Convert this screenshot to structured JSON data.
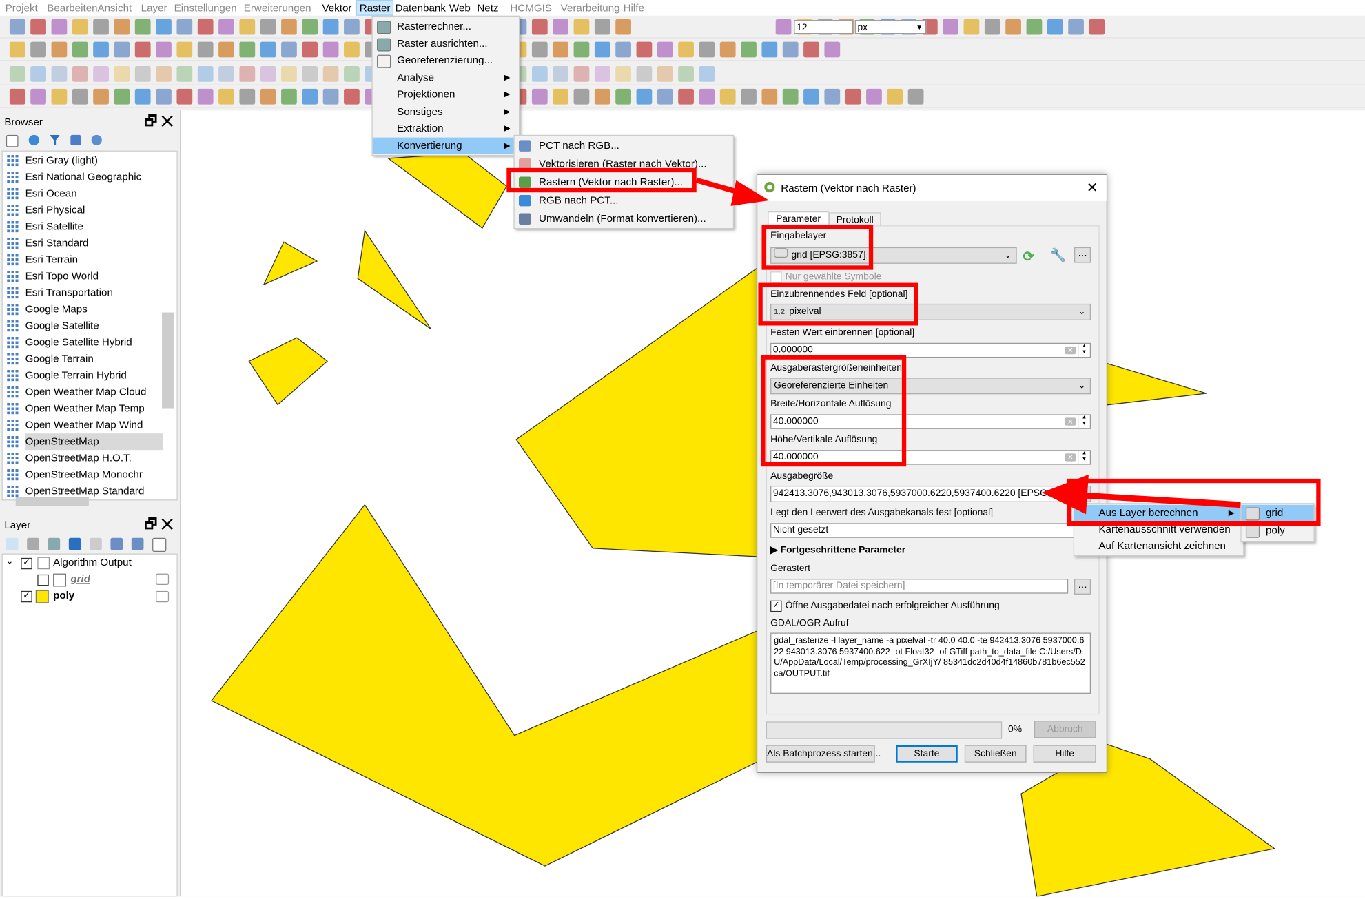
{
  "menubar": [
    {
      "label": "Projekt",
      "enabled": false
    },
    {
      "label": "Bearbeiten",
      "enabled": false
    },
    {
      "label": "Ansicht",
      "enabled": false
    },
    {
      "label": "Layer",
      "enabled": false
    },
    {
      "label": "Einstellungen",
      "enabled": false
    },
    {
      "label": "Erweiterungen",
      "enabled": false
    },
    {
      "label": "Vektor",
      "enabled": true
    },
    {
      "label": "Raster",
      "enabled": true,
      "active": true
    },
    {
      "label": "Datenbank",
      "enabled": true
    },
    {
      "label": "Web",
      "enabled": true
    },
    {
      "label": "Netz",
      "enabled": true
    },
    {
      "label": "HCMGIS",
      "enabled": false
    },
    {
      "label": "Verarbeitung",
      "enabled": false
    },
    {
      "label": "Hilfe",
      "enabled": false
    }
  ],
  "toolbar": {
    "scale_value": "12",
    "scale_unit": "px"
  },
  "raster_menu": {
    "items": [
      {
        "label": "Rasterrechner...",
        "submenu": false
      },
      {
        "label": "Raster ausrichten...",
        "submenu": false
      },
      {
        "label": "Georeferenzierung...",
        "submenu": false
      },
      {
        "label": "Analyse",
        "submenu": true
      },
      {
        "label": "Projektionen",
        "submenu": true
      },
      {
        "label": "Sonstiges",
        "submenu": true
      },
      {
        "label": "Extraktion",
        "submenu": true
      },
      {
        "label": "Konvertierung",
        "submenu": true,
        "highlighted": true
      }
    ]
  },
  "konvertierung_menu": {
    "items": [
      {
        "label": "PCT nach RGB...",
        "enabled": true
      },
      {
        "label": "Vektorisieren (Raster nach Vektor)...",
        "enabled": true
      },
      {
        "label": "Rastern (Vektor nach Raster)...",
        "enabled": true
      },
      {
        "label": "RGB nach PCT...",
        "enabled": true
      },
      {
        "label": "Umwandeln (Format konvertieren)...",
        "enabled": true
      }
    ]
  },
  "browser": {
    "title": "Browser",
    "items": [
      "Esri Gray (light)",
      "Esri National Geographic",
      "Esri Ocean",
      "Esri Physical",
      "Esri Satellite",
      "Esri Standard",
      "Esri Terrain",
      "Esri Topo World",
      "Esri Transportation",
      "Google Maps",
      "Google Satellite",
      "Google Satellite Hybrid",
      "Google Terrain",
      "Google Terrain Hybrid",
      "Open Weather Map Cloud",
      "Open Weather Map Temp",
      "Open Weather Map Wind",
      "OpenStreetMap",
      "OpenStreetMap H.O.T.",
      "OpenStreetMap Monochr",
      "OpenStreetMap Standard"
    ],
    "selected": "OpenStreetMap"
  },
  "layers": {
    "title": "Layer",
    "group": {
      "label": "Algorithm Output",
      "checked": true
    },
    "items": [
      {
        "label": "grid",
        "checked": false,
        "color": "#ffffff"
      },
      {
        "label": "poly",
        "checked": true,
        "color": "#ffe600"
      }
    ]
  },
  "map": {
    "fill_color": "#ffe600",
    "stroke_color": "#333333"
  },
  "dialog": {
    "title": "Rastern (Vektor nach Raster)",
    "tabs": [
      "Parameter",
      "Protokoll"
    ],
    "input_layer_label": "Eingabelayer",
    "input_layer_value": "grid [EPSG:3857]",
    "selected_only_label": "Nur gewählte Symbole",
    "burn_field_label": "Einzubrennendes Feld [optional]",
    "burn_field_type": "1.2",
    "burn_field_value": "pixelval",
    "fixed_value_label": "Festen Wert einbrennen [optional]",
    "fixed_value": "0.000000",
    "units_label": "Ausgaberastergrößeneinheiten",
    "units_value": "Georeferenzierte Einheiten",
    "width_label": "Breite/Horizontale Auflösung",
    "width_value": "40.000000",
    "height_label": "Höhe/Vertikale Auflösung",
    "height_value": "40.000000",
    "extent_label": "Ausgabegröße",
    "extent_value": "942413.3076,943013.3076,5937000.6220,5937400.6220 [EPSG:3857]",
    "nodata_label": "Legt den Leerwert des Ausgabekanals fest [optional]",
    "nodata_value": "Nicht gesetzt",
    "advanced_label": "Fortgeschrittene Parameter",
    "output_label": "Gerastert",
    "output_placeholder": "[In temporärer Datei speichern]",
    "open_output_label": "Öffne Ausgabedatei nach erfolgreicher Ausführung",
    "gdal_label": "GDAL/OGR Aufruf",
    "gdal_command": "gdal_rasterize -l layer_name -a pixelval -tr 40.0 40.0 -te 942413.3076 5937000.622 943013.3076 5937400.622 -ot Float32 -of GTiff path_to_data_file C:/Users/DU/AppData/Local/Temp/processing_GrXIjY/ 85341dc2d40d4f14860b781b6ec552ca/OUTPUT.tif",
    "progress": "0%",
    "progress_value": 0,
    "cancel": "Abbruch",
    "batch": "Als Batchprozess starten...",
    "run": "Starte",
    "close": "Schließen",
    "help": "Hilfe"
  },
  "extent_menu": {
    "items": [
      "Aus Layer berechnen",
      "Kartenausschnitt verwenden",
      "Auf Kartenansicht zeichnen"
    ],
    "layer_submenu": [
      "grid",
      "poly"
    ]
  },
  "annotation_color": "#ff0000"
}
